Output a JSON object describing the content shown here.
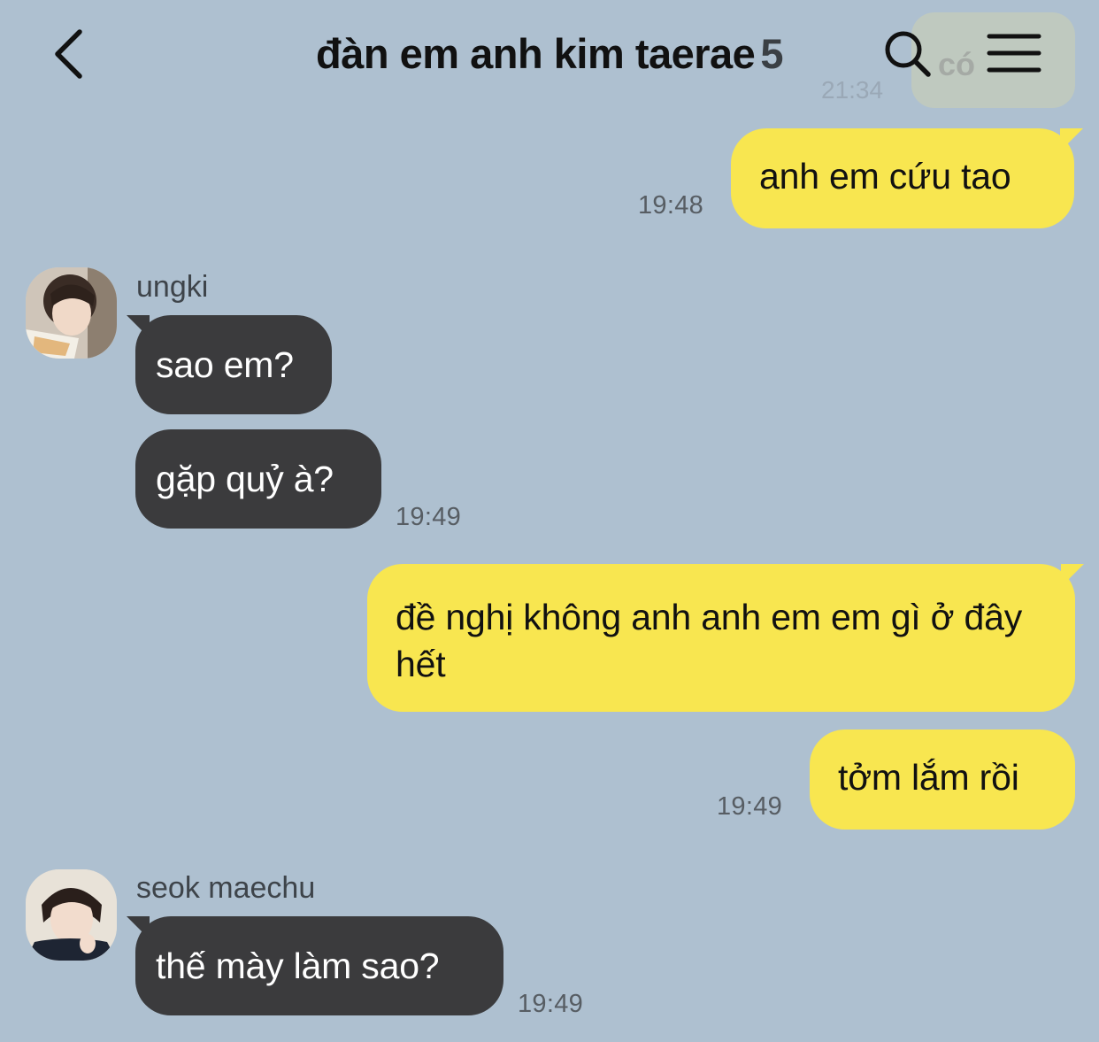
{
  "header": {
    "title": "đàn em anh kim taerae",
    "member_count": "5",
    "back_icon": "chevron-left-icon",
    "search_icon": "search-icon",
    "menu_icon": "hamburger-menu-icon"
  },
  "faded_residue": {
    "text": "có",
    "time": "21:34"
  },
  "colors": {
    "background": "#aec0d0",
    "my_bubble": "#f8e650",
    "their_bubble": "#3b3b3d"
  },
  "messages": [
    {
      "from": "me",
      "text": "anh em cứu tao",
      "time": "19:48"
    },
    {
      "from": "ungki",
      "sender": "ungki",
      "texts": [
        "sao em?",
        "gặp quỷ à?"
      ],
      "time": "19:49"
    },
    {
      "from": "me",
      "text": "đề nghị không anh anh em em gì ở đây hết"
    },
    {
      "from": "me",
      "text": "tởm lắm rồi",
      "time": "19:49"
    },
    {
      "from": "seok maechu",
      "sender": "seok maechu",
      "text": "thế mày làm sao?",
      "time": "19:49"
    }
  ]
}
